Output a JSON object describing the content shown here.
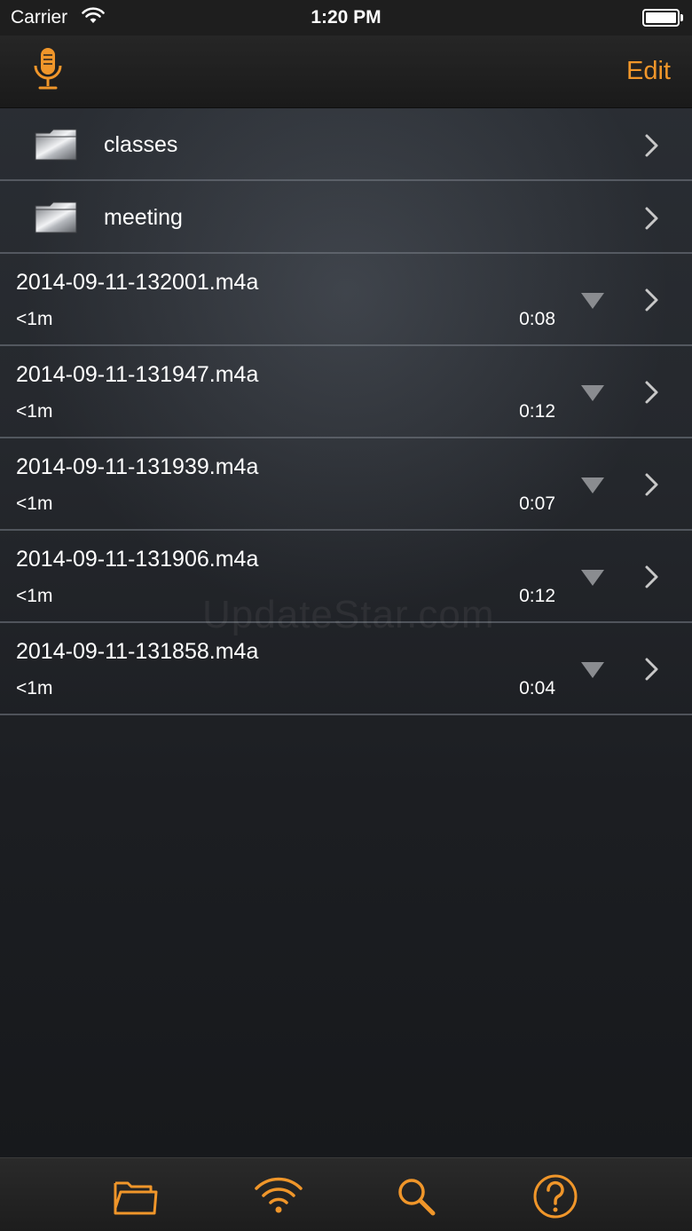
{
  "status_bar": {
    "carrier": "Carrier",
    "time": "1:20 PM"
  },
  "nav": {
    "left_icon": "microphone-icon",
    "edit_label": "Edit"
  },
  "folders": [
    {
      "name": "classes",
      "icon": "folder-icon"
    },
    {
      "name": "meeting",
      "icon": "folder-icon"
    }
  ],
  "recordings": [
    {
      "name": "2014-09-11-132001.m4a",
      "size": "<1m",
      "duration": "0:08"
    },
    {
      "name": "2014-09-11-131947.m4a",
      "size": "<1m",
      "duration": "0:12"
    },
    {
      "name": "2014-09-11-131939.m4a",
      "size": "<1m",
      "duration": "0:07"
    },
    {
      "name": "2014-09-11-131906.m4a",
      "size": "<1m",
      "duration": "0:12"
    },
    {
      "name": "2014-09-11-131858.m4a",
      "size": "<1m",
      "duration": "0:04"
    }
  ],
  "watermark": "UpdateStar.com",
  "tabbar": {
    "items": [
      "folder-icon",
      "wifi-icon",
      "search-icon",
      "help-icon"
    ]
  },
  "colors": {
    "accent": "#f0962a",
    "background": "#1b1d21",
    "separator": "#787d87"
  }
}
